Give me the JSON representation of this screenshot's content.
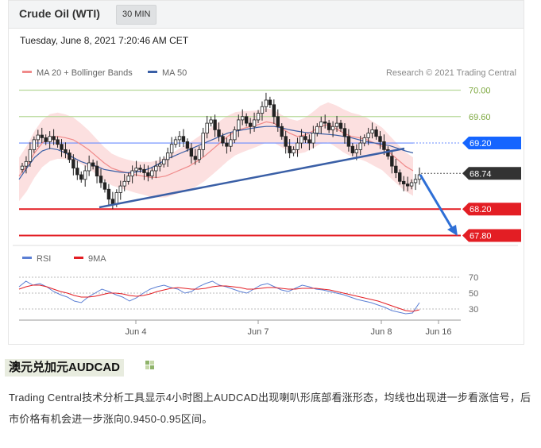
{
  "card": {
    "title": "Crude Oil (WTI)",
    "timeframe": "30 MIN",
    "datetime": "Tuesday, June 8, 2021 7:20:46 AM CET"
  },
  "chart_data": [
    {
      "type": "line",
      "legend": [
        {
          "name": "MA 20 + Bollinger Bands",
          "color": "#f08a8a"
        },
        {
          "name": "MA 50",
          "color": "#3a5fa6"
        }
      ],
      "credit": "Research © 2021 Trading Central",
      "ylim": [
        67.72,
        70.08
      ],
      "x_tick_labels": [
        "Jun 4",
        "Jun 7",
        "Jun 8",
        "Jun 16"
      ],
      "levels": [
        {
          "label": "70.00",
          "value": 70.0,
          "style": "resistance-line",
          "color": "#b7d99a"
        },
        {
          "label": "69.60",
          "value": 69.6,
          "style": "resistance-line",
          "color": "#b7d99a"
        },
        {
          "label": "69.20",
          "value": 69.2,
          "style": "pivot",
          "color": "#1565ff"
        },
        {
          "label": "68.74",
          "value": 68.74,
          "style": "last-price",
          "color": "#333333"
        },
        {
          "label": "68.20",
          "value": 68.2,
          "style": "support",
          "color": "#e31e24"
        },
        {
          "label": "67.80",
          "value": 67.8,
          "style": "support",
          "color": "#e31e24"
        }
      ],
      "candles": [
        68.85,
        68.92,
        69.1,
        69.25,
        69.32,
        69.28,
        69.22,
        69.3,
        69.25,
        69.18,
        69.1,
        69.05,
        68.95,
        68.82,
        68.72,
        68.65,
        68.78,
        68.9,
        68.85,
        68.7,
        68.6,
        68.5,
        68.35,
        68.28,
        68.45,
        68.55,
        68.62,
        68.7,
        68.78,
        68.82,
        68.8,
        68.75,
        68.7,
        68.78,
        68.85,
        68.88,
        68.95,
        69.05,
        69.18,
        69.25,
        69.3,
        69.22,
        69.12,
        69.0,
        68.95,
        69.1,
        69.35,
        69.5,
        69.55,
        69.4,
        69.3,
        69.2,
        69.15,
        69.25,
        69.4,
        69.55,
        69.6,
        69.5,
        69.45,
        69.55,
        69.65,
        69.75,
        69.85,
        69.78,
        69.6,
        69.45,
        69.3,
        69.15,
        69.05,
        69.1,
        69.2,
        69.3,
        69.25,
        69.2,
        69.35,
        69.45,
        69.52,
        69.5,
        69.4,
        69.45,
        69.5,
        69.42,
        69.3,
        69.15,
        69.05,
        69.1,
        69.2,
        69.28,
        69.35,
        69.4,
        69.3,
        69.22,
        69.1,
        69.0,
        68.85,
        68.75,
        68.62,
        68.58,
        68.55,
        68.6,
        68.65,
        68.72
      ],
      "ma20": [
        68.7,
        68.85,
        69.05,
        69.2,
        69.28,
        69.3,
        69.28,
        69.25,
        69.18,
        69.1,
        69.0,
        68.9,
        68.82,
        68.78,
        68.75,
        68.72,
        68.7,
        68.68,
        68.68,
        68.7,
        68.75,
        68.8,
        68.85,
        68.92,
        69.0,
        69.1,
        69.2,
        69.3,
        69.38,
        69.42,
        69.45,
        69.48,
        69.52,
        69.5,
        69.42,
        69.35,
        69.3,
        69.32,
        69.38,
        69.45,
        69.48,
        69.42,
        69.35,
        69.3,
        69.28,
        69.25,
        69.2,
        69.15,
        69.05,
        68.95,
        68.85,
        68.78
      ],
      "ma50": [
        68.65,
        68.82,
        68.98,
        69.08,
        69.12,
        69.1,
        69.05,
        68.98,
        68.92,
        68.88,
        68.85,
        68.8,
        68.78,
        68.76,
        68.75,
        68.76,
        68.78,
        68.82,
        68.88,
        68.95,
        69.0,
        69.05,
        69.1,
        69.15,
        69.2,
        69.25,
        69.3,
        69.35,
        69.38,
        69.4,
        69.42,
        69.44,
        69.45,
        69.45,
        69.43,
        69.4,
        69.38,
        69.36,
        69.35,
        69.34,
        69.33,
        69.32,
        69.3,
        69.28,
        69.25,
        69.22,
        69.2,
        69.18,
        69.16,
        69.12,
        69.08,
        69.05
      ]
    },
    {
      "type": "line",
      "legend": [
        {
          "name": "RSI",
          "color": "#5b7fd4"
        },
        {
          "name": "9MA",
          "color": "#e31e24"
        }
      ],
      "ylim": [
        20,
        80
      ],
      "y_tick_labels": [
        "70",
        "50",
        "30"
      ],
      "rsi": [
        58,
        65,
        60,
        62,
        58,
        52,
        48,
        45,
        40,
        38,
        45,
        50,
        55,
        52,
        48,
        45,
        40,
        44,
        50,
        55,
        58,
        60,
        57,
        55,
        50,
        52,
        58,
        62,
        65,
        60,
        58,
        55,
        52,
        50,
        55,
        60,
        62,
        58,
        54,
        52,
        56,
        60,
        58,
        55,
        54,
        52,
        50,
        48,
        45,
        42,
        40,
        38,
        35,
        32,
        28,
        26,
        24,
        25,
        38
      ],
      "ma9": [
        55,
        58,
        60,
        60,
        58,
        55,
        52,
        50,
        47,
        45,
        45,
        46,
        48,
        50,
        50,
        49,
        47,
        46,
        47,
        49,
        52,
        54,
        56,
        57,
        56,
        55,
        55,
        56,
        58,
        59,
        59,
        58,
        57,
        55,
        55,
        56,
        57,
        57,
        56,
        55,
        55,
        56,
        56,
        56,
        55,
        54,
        52,
        50,
        48,
        46,
        44,
        42,
        40,
        37,
        34,
        31,
        28,
        27,
        29
      ]
    }
  ],
  "section": {
    "title": "澳元兑加元AUDCAD",
    "text": "Trading  Central技术分析工具显示4小时图上AUDCAD出现喇叭形底部看涨形态，均线也出现进一步看涨信号，后市价格有机会进一步涨向0.9450-0.95区间。"
  }
}
